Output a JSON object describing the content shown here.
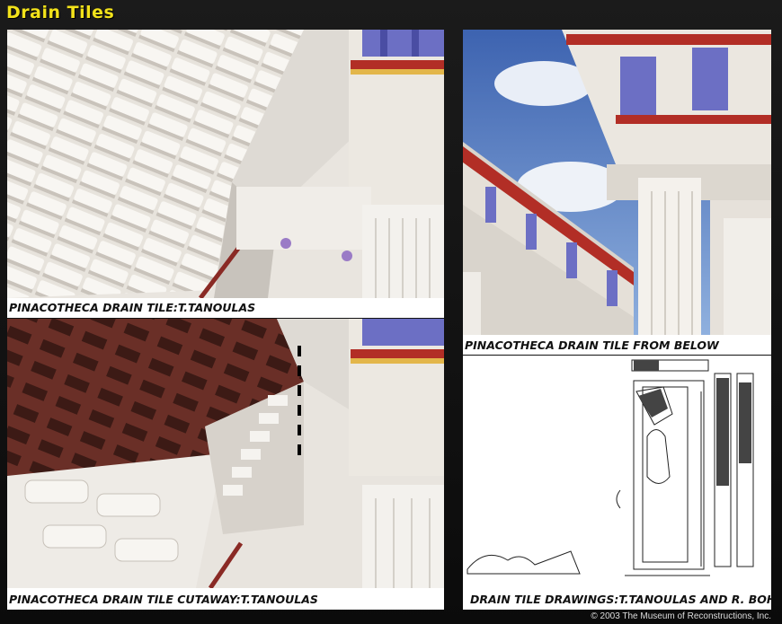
{
  "header": {
    "title": "Drain Tiles"
  },
  "panels": {
    "top_left": {
      "caption": "PINACOTHECA DRAIN TILE:T.TANOULAS"
    },
    "bottom_left": {
      "caption": "PINACOTHECA DRAIN TILE CUTAWAY:T.TANOULAS"
    },
    "top_right": {
      "caption": "PINACOTHECA DRAIN TILE FROM BELOW"
    },
    "bottom_right": {
      "caption": "DRAIN TILE DRAWINGS:T.TANOULAS AND R. BOHN"
    }
  },
  "footer": {
    "copyright": "© 2003 The Museum of Reconstructions, Inc."
  },
  "colors": {
    "title": "#f2e21a",
    "tile": "#ece8e2",
    "terracotta": "#5e2a22",
    "column_blue": "#6c6fc4"
  }
}
